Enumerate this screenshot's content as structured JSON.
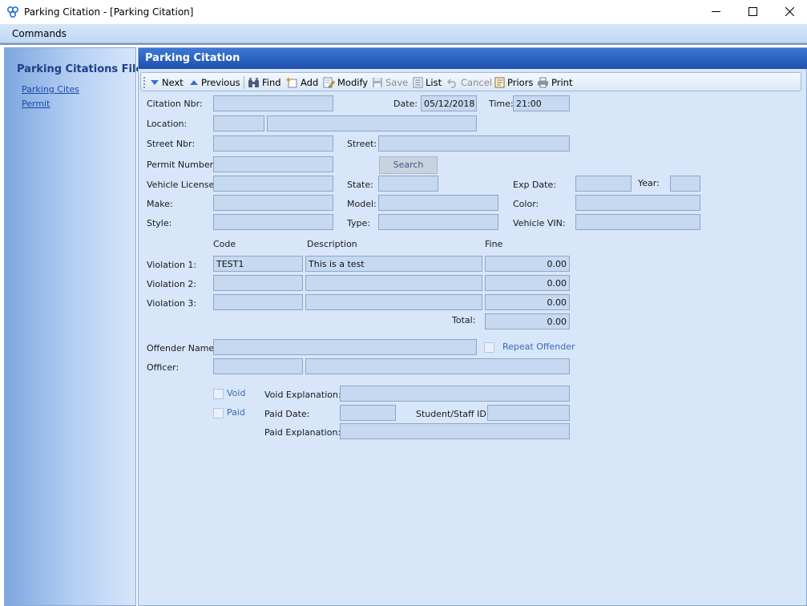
{
  "window": {
    "title": "Parking Citation - [Parking Citation]"
  },
  "menu": {
    "commands": "Commands"
  },
  "sidebar": {
    "title": "Parking Citations Files:",
    "links": [
      "Parking Cites",
      "Permit"
    ]
  },
  "panel": {
    "title": "Parking Citation"
  },
  "toolbar": {
    "next": "Next",
    "previous": "Previous",
    "find": "Find",
    "add": "Add",
    "modify": "Modify",
    "save": "Save",
    "list": "List",
    "cancel": "Cancel",
    "priors": "Priors",
    "print": "Print"
  },
  "form": {
    "citation_nbr_label": "Citation Nbr:",
    "citation_nbr": "",
    "date_label": "Date:",
    "date": "05/12/2018",
    "time_label": "Time:",
    "time": "21:00",
    "location_label": "Location:",
    "location_code": "",
    "location_desc": "",
    "street_nbr_label": "Street Nbr:",
    "street_nbr": "",
    "street_label": "Street:",
    "street": "",
    "permit_number_label": "Permit Number:",
    "permit_number": "",
    "search_button": "Search",
    "vehicle_license_label": "Vehicle License:",
    "vehicle_license": "",
    "state_label": "State:",
    "state": "",
    "exp_date_label": "Exp Date:",
    "exp_date": "",
    "year_label": "Year:",
    "year": "",
    "make_label": "Make:",
    "make": "",
    "model_label": "Model:",
    "model": "",
    "color_label": "Color:",
    "color": "",
    "style_label": "Style:",
    "style": "",
    "type_label": "Type:",
    "type": "",
    "vin_label": "Vehicle VIN:",
    "vin": "",
    "col_code": "Code",
    "col_description": "Description",
    "col_fine": "Fine",
    "violations": [
      {
        "label": "Violation 1:",
        "code": "TEST1",
        "description": "This is a test",
        "fine": "0.00"
      },
      {
        "label": "Violation 2:",
        "code": "",
        "description": "",
        "fine": "0.00"
      },
      {
        "label": "Violation 3:",
        "code": "",
        "description": "",
        "fine": "0.00"
      }
    ],
    "total_label": "Total:",
    "total": "0.00",
    "offender_name_label": "Offender Name:",
    "offender_name": "",
    "repeat_offender_label": "Repeat Offender",
    "officer_label": "Officer:",
    "officer_code": "",
    "officer_name": "",
    "void_label": "Void",
    "void_explanation_label": "Void Explanation:",
    "void_explanation": "",
    "paid_label": "Paid",
    "paid_date_label": "Paid Date:",
    "paid_date": "",
    "student_staff_id_label": "Student/Staff ID:",
    "student_staff_id": "",
    "paid_explanation_label": "Paid Explanation:",
    "paid_explanation": ""
  }
}
